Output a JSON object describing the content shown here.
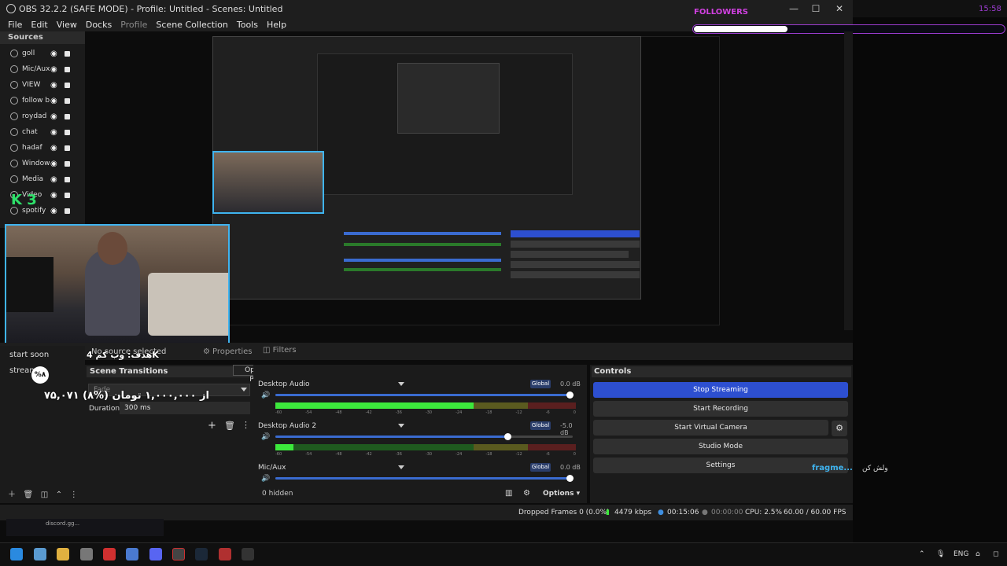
{
  "window": {
    "title": "OBS 32.2.2 (SAFE MODE) - Profile: Untitled - Scenes: Untitled",
    "minimize": "—",
    "maximize": "☐",
    "close": "✕"
  },
  "menu": [
    "File",
    "Edit",
    "View",
    "Docks",
    "Profile",
    "Scene Collection",
    "Tools",
    "Help"
  ],
  "sources": {
    "header": "Sources",
    "items": [
      {
        "name": "goll",
        "icon": "globe-icon"
      },
      {
        "name": "Mic/Aux",
        "icon": "mic-icon"
      },
      {
        "name": "VIEW",
        "icon": "globe-icon"
      },
      {
        "name": "follow b",
        "icon": "globe-icon"
      },
      {
        "name": "roydad",
        "icon": "globe-icon"
      },
      {
        "name": "chat",
        "icon": "globe-icon"
      },
      {
        "name": "hadaf",
        "icon": "globe-icon"
      },
      {
        "name": "Window",
        "icon": "window-icon"
      },
      {
        "name": "Media",
        "icon": "play-icon"
      },
      {
        "name": "Video",
        "icon": "camera-icon"
      },
      {
        "name": "spotify",
        "icon": "globe-icon"
      }
    ]
  },
  "overlay": {
    "followers_label": "FOLLOWERS",
    "followers_progress": 0.3,
    "k3": "K 3",
    "goal_fa": "هدف: وب کم 4K",
    "amount_fa": "۷۵,۰۷۱ از ۱,۰۰۰,۰۰۰ تومان (%۸)",
    "badge": "%۸",
    "fragme": "fragme...",
    "fragme_fa": "ولش کن"
  },
  "scenes": {
    "items": [
      "start soon",
      "stream"
    ]
  },
  "source_bar": {
    "no_source": "No source selected",
    "properties": "Properties",
    "filters": "Filters",
    "tooltip": "Open Source Properties"
  },
  "transitions": {
    "header": "Scene Transitions",
    "selected": "Fade",
    "duration_label": "Duration",
    "duration_value": "300 ms"
  },
  "mixer": {
    "channels": [
      {
        "name": "Desktop Audio",
        "global": "Global",
        "db": "0.0 dB",
        "volume": 1.0,
        "level": 0.66
      },
      {
        "name": "Desktop Audio 2",
        "global": "Global",
        "db": "-5.0 dB",
        "volume": 0.79,
        "level": 0.06
      },
      {
        "name": "Mic/Aux",
        "global": "Global",
        "db": "0.0 dB",
        "volume": 1.0,
        "level": 0.0
      }
    ],
    "ticks": [
      "-60",
      "-54",
      "-48",
      "-42",
      "-36",
      "-30",
      "-24",
      "-18",
      "-12",
      "-6",
      "0"
    ],
    "hidden": "0 hidden",
    "options": "Options"
  },
  "controls": {
    "header": "Controls",
    "stop_streaming": "Stop Streaming",
    "start_recording": "Start Recording",
    "start_virtual_camera": "Start Virtual Camera",
    "studio_mode": "Studio Mode",
    "settings": "Settings"
  },
  "status": {
    "dropped": "Dropped Frames 0 (0.0%)",
    "bitrate": "4479 kbps",
    "stream_time": "00:15:06",
    "rec_time": "00:00:00",
    "cpu": "CPU: 2.5%",
    "fps": "60.00 / 60.00 FPS"
  },
  "discord": "discord.gg...",
  "taskbar": {
    "lang": "ENG",
    "clock": "15:58"
  },
  "colors": {
    "accent": "#2d4fd0",
    "webcam_border": "#3fb4f0",
    "followers": "#d040e0",
    "k3": "#2ee06a"
  }
}
